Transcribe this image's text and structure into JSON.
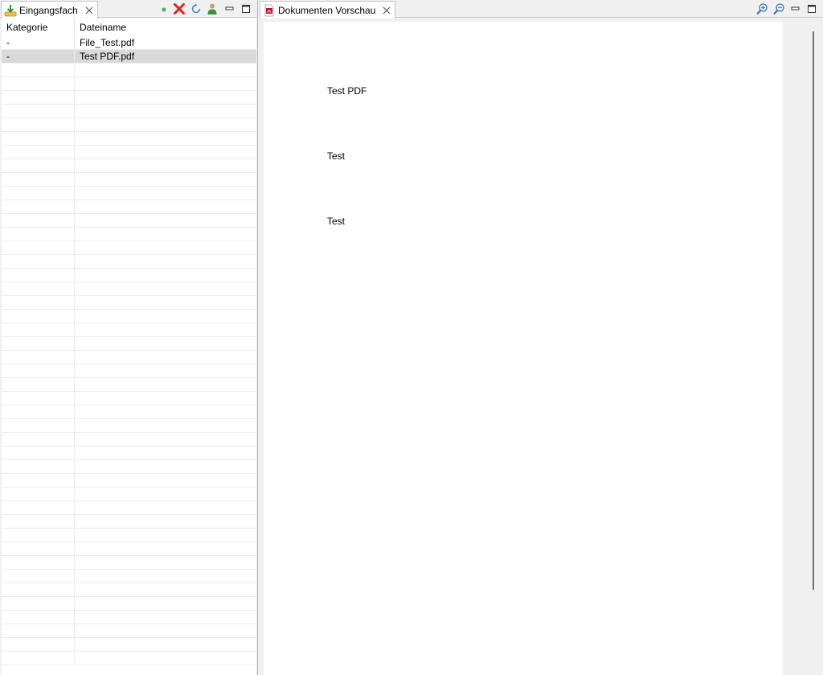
{
  "left_panel": {
    "tab_label": "Eingangsfach",
    "columns": [
      "Kategorie",
      "Dateiname"
    ],
    "rows": [
      {
        "kategorie": "-",
        "dateiname": "File_Test.pdf",
        "selected": false
      },
      {
        "kategorie": "-",
        "dateiname": "Test PDF.pdf",
        "selected": true
      }
    ],
    "empty_row_count": 44
  },
  "right_panel": {
    "tab_label": "Dokumenten Vorschau",
    "document_lines": [
      "Test PDF",
      "Test",
      "Test"
    ]
  },
  "colors": {
    "selected_row": "#d9d9d9",
    "delete_red": "#e02020",
    "status_green": "#4caf50",
    "refresh_blue": "#3a8fd8"
  },
  "icons": {
    "left_tab": "inbox-download-icon",
    "right_tab": "pdf-icon",
    "toolbar_left": [
      "status-dot-icon",
      "delete-icon",
      "refresh-icon",
      "assign-user-icon",
      "minimize-icon",
      "maximize-icon"
    ],
    "toolbar_right": [
      "zoom-in-icon",
      "zoom-out-icon",
      "minimize-icon",
      "maximize-icon"
    ]
  }
}
